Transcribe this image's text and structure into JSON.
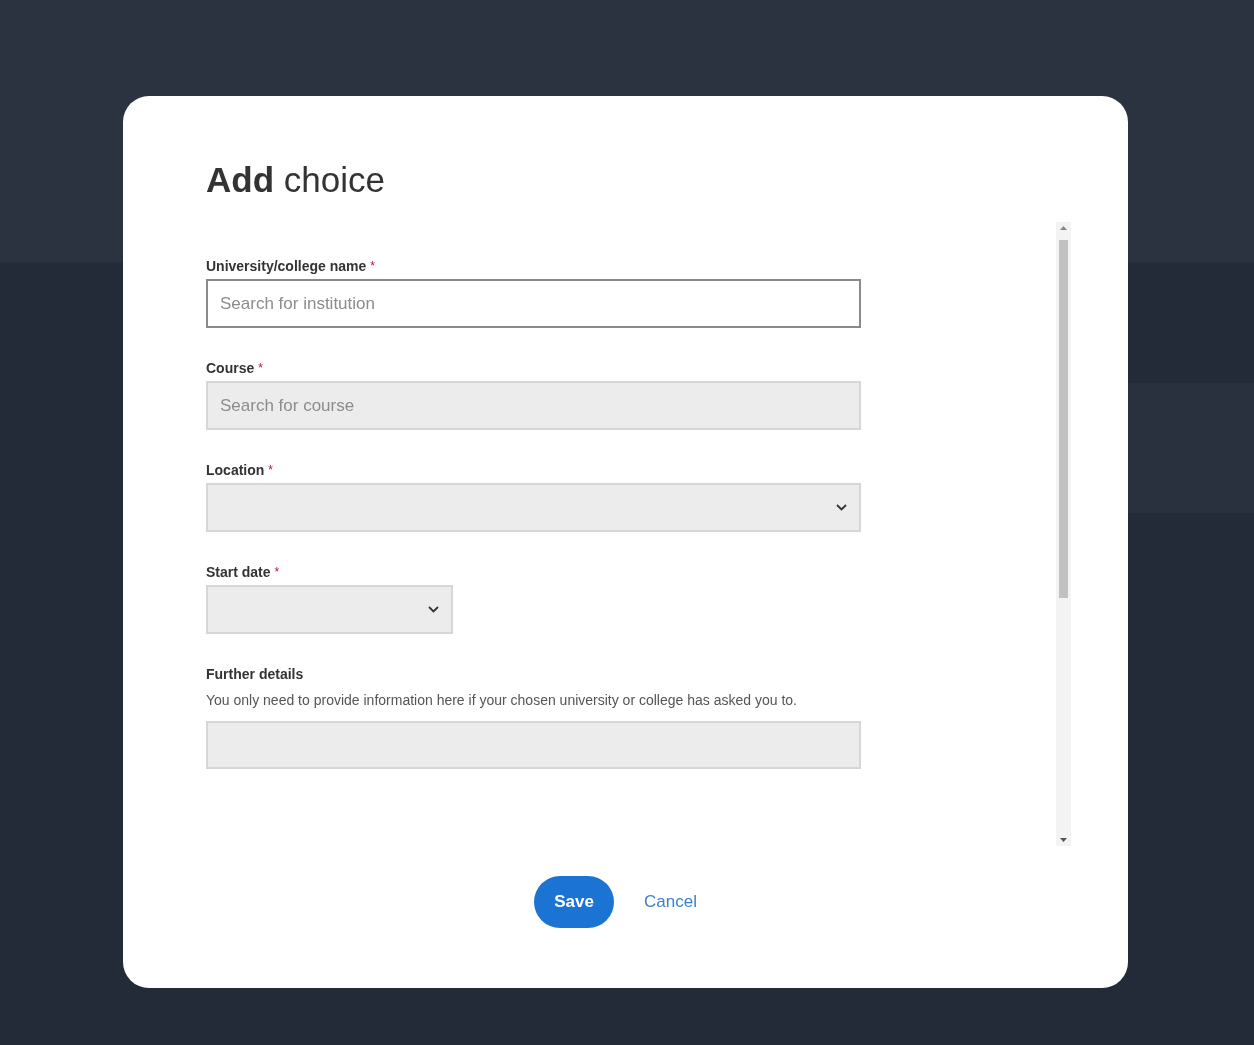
{
  "dialog": {
    "title": "**Add** choice",
    "fields": [
      {
        "kind": "text",
        "label": "University/college name",
        "required_mark": "*",
        "placeholder": "Search for institution",
        "disabled": false
      },
      {
        "kind": "text",
        "label": "Course",
        "required_mark": "*",
        "placeholder": "Search for course",
        "disabled": true
      },
      {
        "kind": "select",
        "label": "Location",
        "required_mark": "*",
        "disabled": true
      },
      {
        "kind": "short-select",
        "label": "Start date",
        "required_mark": "*",
        "disabled": true
      },
      {
        "kind": "textarea",
        "label": "Further details",
        "hint": "You only need to provide information here if your chosen university or college has asked you to.",
        "disabled": true
      }
    ],
    "buttons": [
      {
        "kind": "primary",
        "label": "Save"
      },
      {
        "kind": "link",
        "label": "Cancel"
      }
    ]
  }
}
